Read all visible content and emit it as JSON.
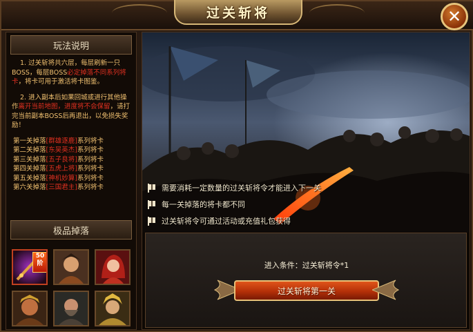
{
  "window": {
    "title": "过关斩将",
    "close_label": "✕"
  },
  "rules": {
    "header": "玩法说明",
    "p1_a": "1. 过关斩将共六层，每层刷新一只BOSS，每层BOSS",
    "p1_red": "必定掉落不同系列将卡",
    "p1_b": "，将卡可用于激活将卡图鉴。",
    "p2_a": "2. 进入副本后如果回城或进行其他操作",
    "p2_red": "离开当前地图，进度将不会保留",
    "p2_b": "，请打完当前副本BOSS后再退出，以免损失奖励！",
    "drops": [
      {
        "prefix": "第一关掉落",
        "name": "[群雄逐鹿]",
        "suffix": "系列将卡"
      },
      {
        "prefix": "第二关掉落",
        "name": "[东吴英杰]",
        "suffix": "系列将卡"
      },
      {
        "prefix": "第三关掉落",
        "name": "[五子良将]",
        "suffix": "系列将卡"
      },
      {
        "prefix": "第四关掉落",
        "name": "[五虎上将]",
        "suffix": "系列将卡"
      },
      {
        "prefix": "第五关掉落",
        "name": "[神机妙算]",
        "suffix": "系列将卡"
      },
      {
        "prefix": "第六关掉落",
        "name": "[三国君主]",
        "suffix": "系列将卡"
      }
    ]
  },
  "rare_drops": {
    "header": "极品掉落",
    "badge": "50阶"
  },
  "notes": [
    "需要消耗一定数量的过关斩将令才能进入下一关",
    "每一关掉落的将卡都不同",
    "过关斩将令可通过活动或充值礼包获得"
  ],
  "entry": {
    "condition": "进入条件：过关斩将令*1",
    "button_label": "过关斩将第一关"
  },
  "colors": {
    "accent_red": "#e03020",
    "rule_text": "#f0c070",
    "button": "#c0400e"
  }
}
